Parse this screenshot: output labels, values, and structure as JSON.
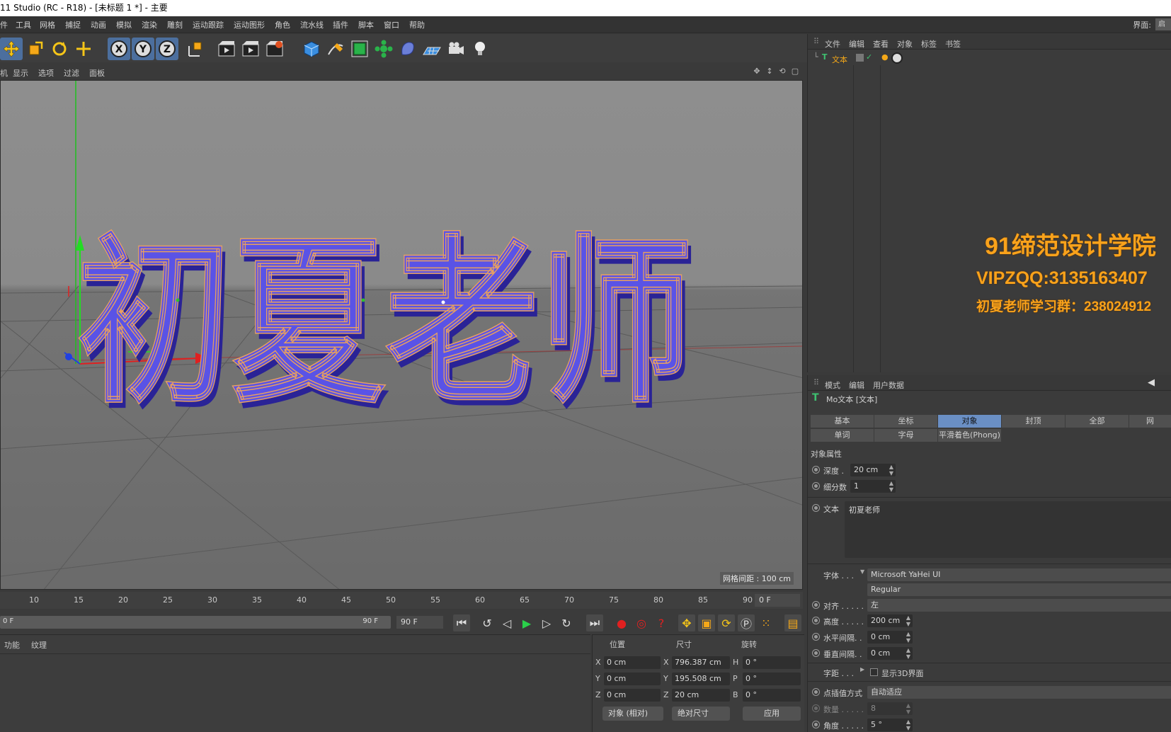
{
  "window": {
    "title": "11 Studio (RC - R18) - [未标题 1 *] - 主要"
  },
  "menubar": {
    "items": [
      "件",
      "工具",
      "网格",
      "捕捉",
      "动画",
      "模拟",
      "渲染",
      "雕刻",
      "运动跟踪",
      "运动图形",
      "角色",
      "流水线",
      "插件",
      "脚本",
      "窗口",
      "帮助"
    ],
    "layout_label": "界面:",
    "layout_value": "启"
  },
  "viewport": {
    "menu": [
      "机",
      "显示",
      "选项",
      "过滤",
      "面板"
    ],
    "grid_spacing": "网格间距 : 100 cm",
    "text3d": "初夏老师",
    "colors": {
      "text_face": "#4a3ee0",
      "text_side": "#7c78e8",
      "outline": "#e8a060",
      "x_axis": "#e02020",
      "y_axis": "#20d020",
      "z_axis": "#2040e0"
    }
  },
  "timeline": {
    "ticks": [
      "10",
      "15",
      "20",
      "25",
      "30",
      "35",
      "40",
      "45",
      "50",
      "55",
      "60",
      "65",
      "70",
      "75",
      "80",
      "85",
      "90"
    ],
    "current_frame": "0 F"
  },
  "playbar": {
    "range_start": "0 F",
    "range_end_label": "90 F",
    "end_frame": "90 F",
    "buttons": [
      "go-to-start",
      "prev-key",
      "prev-frame",
      "play",
      "next-frame",
      "loop",
      "go-to-end"
    ]
  },
  "materials": {
    "tabs": [
      "功能",
      "纹理"
    ]
  },
  "coords": {
    "headers": {
      "position": "位置",
      "size": "尺寸",
      "rotation": "旋转"
    },
    "rows": [
      {
        "axis": "X",
        "pos": "0 cm",
        "size_axis": "X",
        "size": "796.387 cm",
        "rot_axis": "H",
        "rot": "0 °"
      },
      {
        "axis": "Y",
        "pos": "0 cm",
        "size_axis": "Y",
        "size": "195.508 cm",
        "rot_axis": "P",
        "rot": "0 °"
      },
      {
        "axis": "Z",
        "pos": "0 cm",
        "size_axis": "Z",
        "size": "20 cm",
        "rot_axis": "B",
        "rot": "0 °"
      }
    ],
    "mode": "对象 (相对)",
    "size_mode": "绝对尺寸",
    "apply": "应用"
  },
  "object_manager": {
    "menu": [
      "文件",
      "编辑",
      "查看",
      "对象",
      "标签",
      "书签"
    ],
    "object_name": "文本"
  },
  "watermark": {
    "line1": "91缔范设计学院",
    "line2": "VIPZQQ:3135163407",
    "line3": "初夏老师学习群：238024912"
  },
  "attributes": {
    "menu": [
      "模式",
      "编辑",
      "用户数据"
    ],
    "object_title": "Mo文本 [文本]",
    "tabs_row1": [
      "基本",
      "坐标",
      "对象",
      "封顶",
      "全部",
      "网"
    ],
    "tabs_row2": [
      "单词",
      "字母",
      "平滑着色(Phong)"
    ],
    "active_tab": "对象",
    "section": "对象属性",
    "depth_label": "深度 .",
    "depth": "20 cm",
    "subdiv_label": "细分数",
    "subdiv": "1",
    "text_label": "文本",
    "text_value": "初夏老师",
    "font_label": "字体 . . .",
    "font_family": "Microsoft YaHei UI",
    "font_style": "Regular",
    "align_label": "对齐 . . . . .",
    "align": "左",
    "height_label": "高度 . . . . .",
    "height": "200 cm",
    "hspace_label": "水平间隔. .",
    "hspace": "0 cm",
    "vspace_label": "垂直间隔. .",
    "vspace": "0 cm",
    "kerning_label": "字距 . . .",
    "show3d": "显示3D界面",
    "interp_label": "点插值方式",
    "interp": "自动适应",
    "count_label": "数量 . . . . .",
    "count": "8",
    "angle_label": "角度 . . . . .",
    "angle": "5 °"
  }
}
